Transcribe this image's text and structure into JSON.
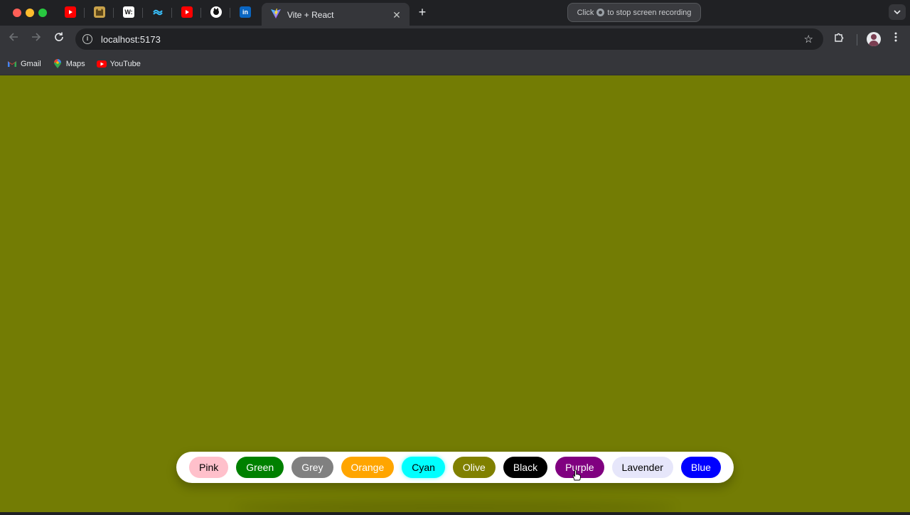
{
  "browser": {
    "active_tab": {
      "title": "Vite + React",
      "close_symbol": "✕"
    },
    "new_tab_symbol": "+",
    "pinned_tabs": [
      {
        "icon": "youtube-icon",
        "color": "#ff0000"
      },
      {
        "icon": "cat-icon",
        "color": "#c9a24a"
      },
      {
        "icon": "wordle-icon",
        "color": "#ffffff",
        "glyph": "W:"
      },
      {
        "icon": "tailwind-icon",
        "color": "#38bdf8"
      },
      {
        "icon": "youtube-icon",
        "color": "#ff0000"
      },
      {
        "icon": "github-icon",
        "color": "#ffffff"
      },
      {
        "icon": "linkedin-icon",
        "color": "#0a66c2",
        "glyph": "in"
      }
    ],
    "recording": {
      "prefix": "Click",
      "suffix": "to stop screen recording"
    },
    "address": {
      "url": "localhost:5173"
    },
    "bookmarks": [
      {
        "label": "Gmail",
        "icon": "gmail-icon"
      },
      {
        "label": "Maps",
        "icon": "maps-icon"
      },
      {
        "label": "YouTube",
        "icon": "youtube-icon"
      }
    ]
  },
  "page": {
    "background_color": "#737c04",
    "colors": [
      {
        "label": "Pink",
        "bg": "#ffc0cb",
        "fg": "#000000"
      },
      {
        "label": "Green",
        "bg": "#008000",
        "fg": "#ffffff"
      },
      {
        "label": "Grey",
        "bg": "#808080",
        "fg": "#ffffff"
      },
      {
        "label": "Orange",
        "bg": "#ffa500",
        "fg": "#ffffff"
      },
      {
        "label": "Cyan",
        "bg": "#00ffff",
        "fg": "#000000"
      },
      {
        "label": "Olive",
        "bg": "#808000",
        "fg": "#ffffff"
      },
      {
        "label": "Black",
        "bg": "#000000",
        "fg": "#ffffff"
      },
      {
        "label": "Purple",
        "bg": "#800080",
        "fg": "#ffffff"
      },
      {
        "label": "Lavender",
        "bg": "#e6e6fa",
        "fg": "#000000"
      },
      {
        "label": "Blue",
        "bg": "#0000ff",
        "fg": "#ffffff"
      }
    ]
  }
}
